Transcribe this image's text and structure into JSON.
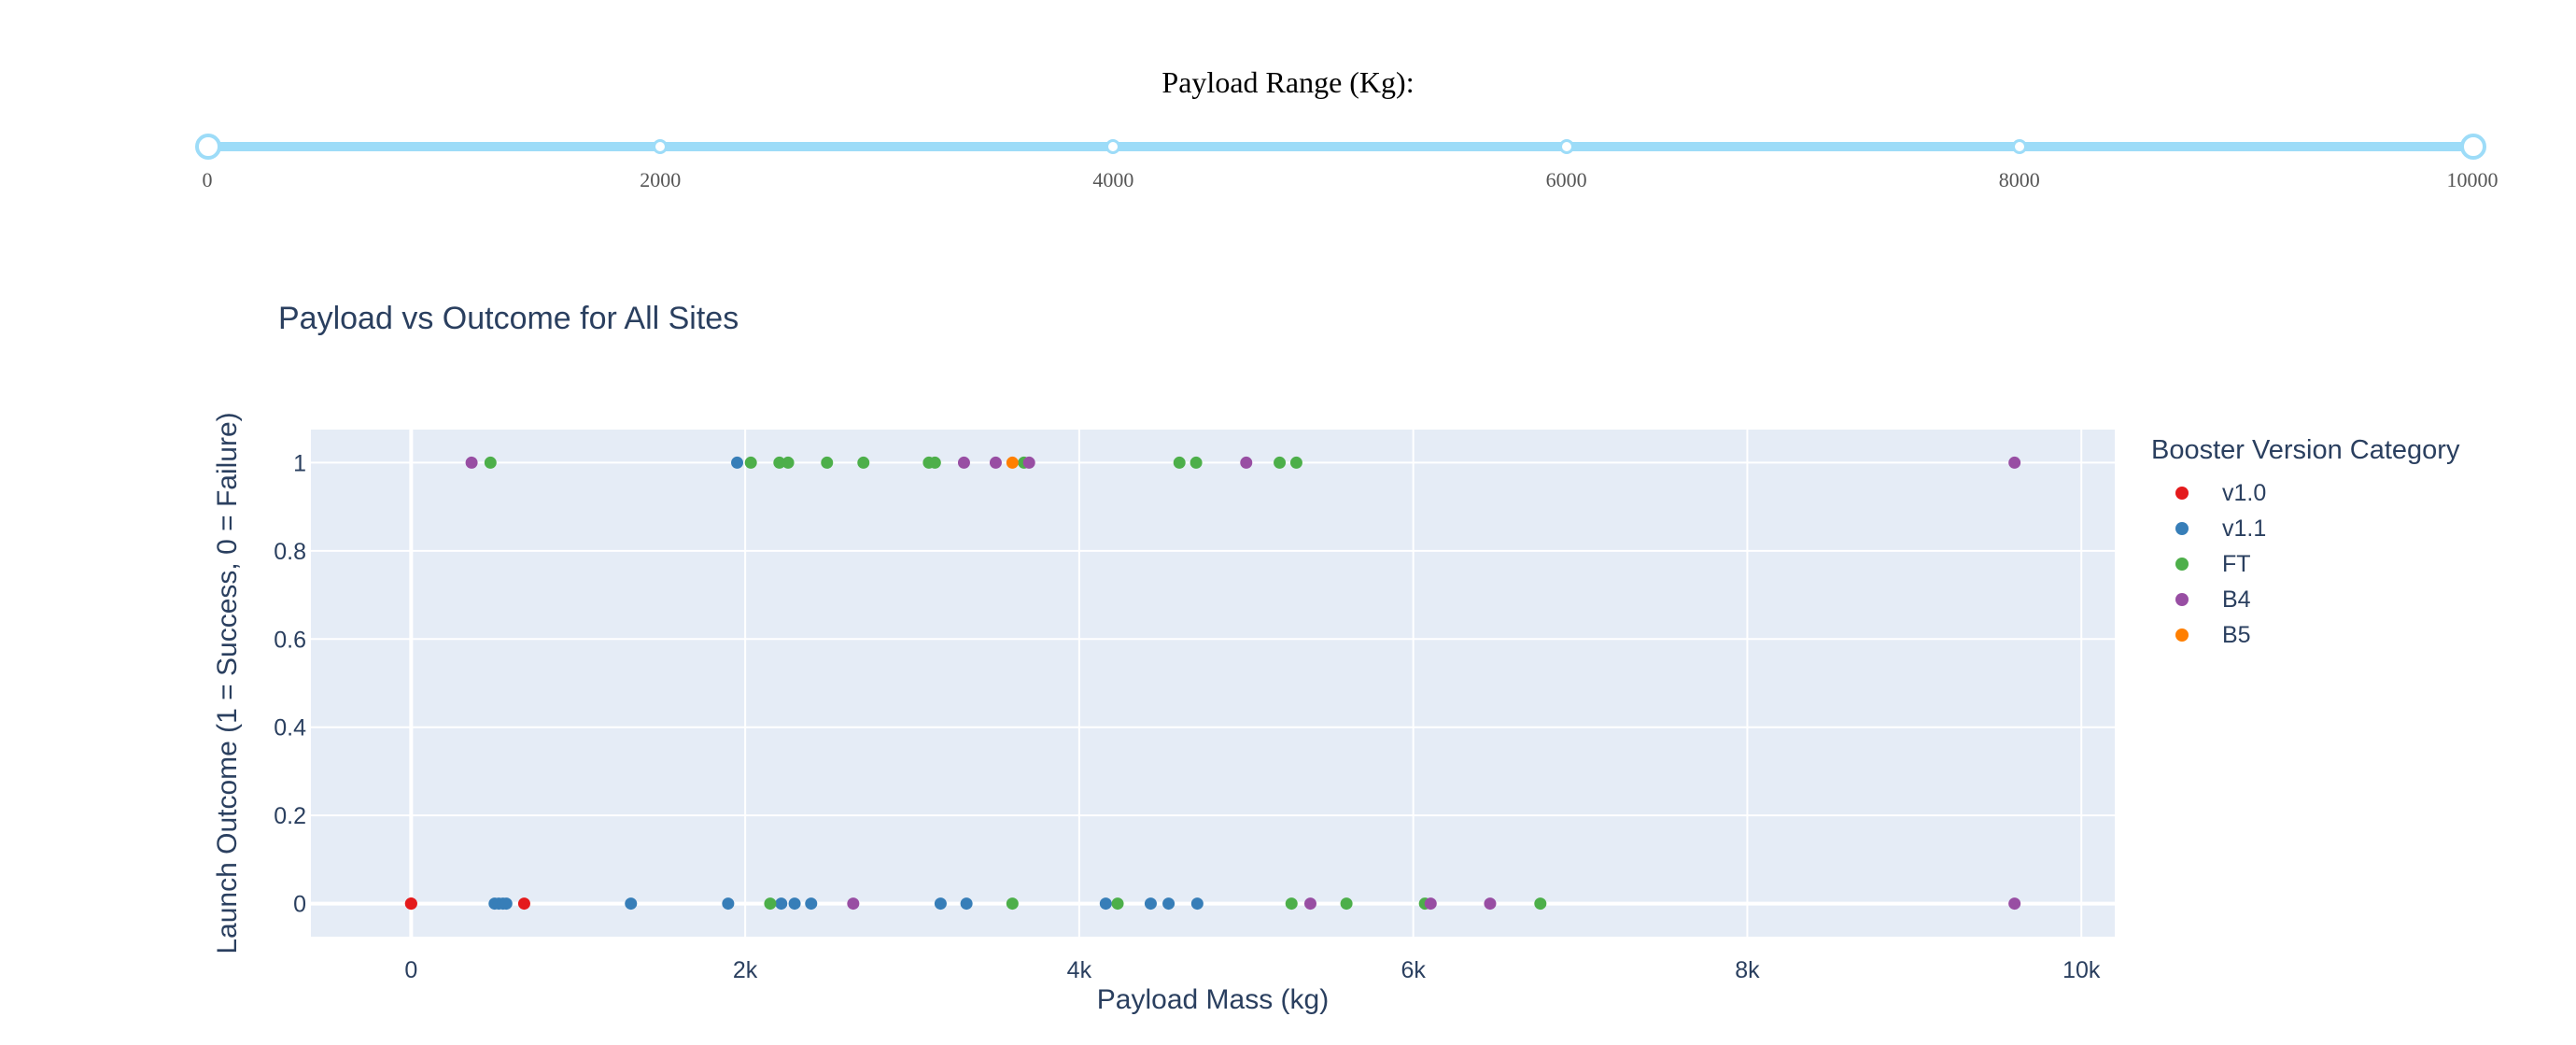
{
  "slider": {
    "title": "Payload Range (Kg):",
    "min": 0,
    "max": 10000,
    "selected": [
      0,
      10000
    ],
    "marks": [
      "0",
      "2000",
      "4000",
      "6000",
      "8000",
      "10000"
    ]
  },
  "chart_data": {
    "type": "scatter",
    "title": "Payload vs Outcome for All Sites",
    "xlabel": "Payload Mass (kg)",
    "ylabel": "Launch Outcome (1 = Success, 0 = Failure)",
    "xlim": [
      -600,
      10200
    ],
    "ylim": [
      -0.075,
      1.075
    ],
    "xticks": [
      0,
      2000,
      4000,
      6000,
      8000,
      10000
    ],
    "xtick_labels": [
      "0",
      "2k",
      "4k",
      "6k",
      "8k",
      "10k"
    ],
    "yticks": [
      0,
      0.2,
      0.4,
      0.6,
      0.8,
      1
    ],
    "ytick_labels": [
      "0",
      "0.2",
      "0.4",
      "0.6",
      "0.8",
      "1"
    ],
    "grid": true,
    "legend_title": "Booster Version Category",
    "legend_position": "right",
    "series": [
      {
        "name": "v1.0",
        "color": "#e41a1c",
        "points": [
          [
            0,
            0
          ],
          [
            0,
            0
          ],
          [
            677,
            0
          ]
        ]
      },
      {
        "name": "v1.1",
        "color": "#377eb8",
        "points": [
          [
            500,
            0
          ],
          [
            525,
            0
          ],
          [
            550,
            0
          ],
          [
            570,
            0
          ],
          [
            1316,
            0
          ],
          [
            1898,
            0
          ],
          [
            1952,
            1
          ],
          [
            2216,
            0
          ],
          [
            2296,
            0
          ],
          [
            2395,
            0
          ],
          [
            3170,
            0
          ],
          [
            3325,
            0
          ],
          [
            4159,
            0
          ],
          [
            4428,
            0
          ],
          [
            4535,
            0
          ],
          [
            4707,
            0
          ]
        ]
      },
      {
        "name": "FT",
        "color": "#4daf4a",
        "points": [
          [
            475,
            1
          ],
          [
            2034,
            1
          ],
          [
            2205,
            1
          ],
          [
            2257,
            1
          ],
          [
            2490,
            1
          ],
          [
            2708,
            1
          ],
          [
            3100,
            1
          ],
          [
            3136,
            1
          ],
          [
            3669,
            1
          ],
          [
            4600,
            1
          ],
          [
            4700,
            1
          ],
          [
            5200,
            1
          ],
          [
            5300,
            1
          ],
          [
            2150,
            0
          ],
          [
            3600,
            0
          ],
          [
            4230,
            0
          ],
          [
            5271,
            0
          ],
          [
            5600,
            0
          ],
          [
            6070,
            0
          ],
          [
            6761,
            0
          ]
        ]
      },
      {
        "name": "B4",
        "color": "#984ea3",
        "points": [
          [
            362,
            1
          ],
          [
            3310,
            1
          ],
          [
            3500,
            1
          ],
          [
            3700,
            1
          ],
          [
            5000,
            1
          ],
          [
            9600,
            1
          ],
          [
            2647,
            0
          ],
          [
            5384,
            0
          ],
          [
            6104,
            0
          ],
          [
            6460,
            0
          ],
          [
            9600,
            0
          ]
        ]
      },
      {
        "name": "B5",
        "color": "#ff7f00",
        "points": [
          [
            3600,
            1
          ]
        ]
      }
    ]
  }
}
